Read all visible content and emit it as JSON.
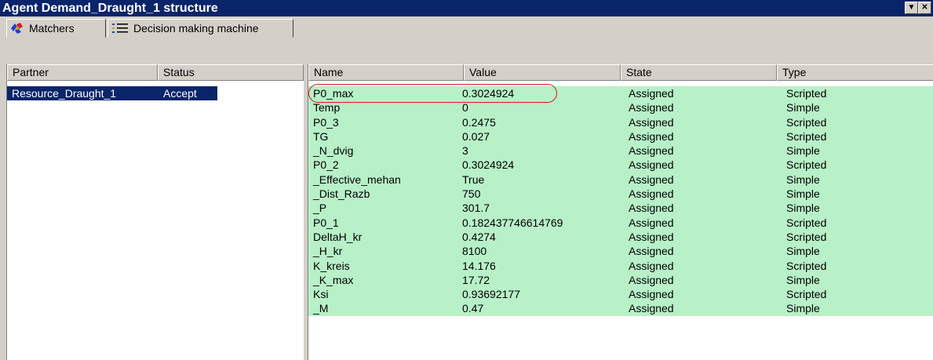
{
  "window": {
    "title": "Agent Demand_Draught_1 structure",
    "buttons": [
      "▼",
      "✕"
    ]
  },
  "tabs": [
    {
      "label": "Matchers",
      "icon": "matchers-icon",
      "active": true
    },
    {
      "label": "Decision making machine",
      "icon": "list-icon",
      "active": false
    }
  ],
  "left_table": {
    "columns": [
      "Partner",
      "Status"
    ],
    "rows": [
      {
        "partner": "Resource_Draught_1",
        "status": "Accept"
      }
    ]
  },
  "right_table": {
    "columns": [
      "Name",
      "Value",
      "State",
      "Type"
    ],
    "rows": [
      {
        "name": "P0_max",
        "value": "0.3024924",
        "state": "Assigned",
        "type": "Scripted"
      },
      {
        "name": "Temp",
        "value": "0",
        "state": "Assigned",
        "type": "Simple"
      },
      {
        "name": "P0_3",
        "value": "0.2475",
        "state": "Assigned",
        "type": "Scripted"
      },
      {
        "name": "TG",
        "value": "0.027",
        "state": "Assigned",
        "type": "Scripted"
      },
      {
        "name": "_N_dvig",
        "value": "3",
        "state": "Assigned",
        "type": "Simple"
      },
      {
        "name": "P0_2",
        "value": "0.3024924",
        "state": "Assigned",
        "type": "Scripted"
      },
      {
        "name": "_Effective_mehan",
        "value": "True",
        "state": "Assigned",
        "type": "Simple"
      },
      {
        "name": "_Dist_Razb",
        "value": "750",
        "state": "Assigned",
        "type": "Simple"
      },
      {
        "name": "_P",
        "value": "301.7",
        "state": "Assigned",
        "type": "Simple"
      },
      {
        "name": "P0_1",
        "value": "0.182437746614769",
        "state": "Assigned",
        "type": "Scripted"
      },
      {
        "name": "DeltaH_kr",
        "value": "0.4274",
        "state": "Assigned",
        "type": "Scripted"
      },
      {
        "name": "_H_kr",
        "value": "8100",
        "state": "Assigned",
        "type": "Simple"
      },
      {
        "name": "K_kreis",
        "value": "14.176",
        "state": "Assigned",
        "type": "Scripted"
      },
      {
        "name": "_K_max",
        "value": "17.72",
        "state": "Assigned",
        "type": "Simple"
      },
      {
        "name": "Ksi",
        "value": "0.93692177",
        "state": "Assigned",
        "type": "Scripted"
      },
      {
        "name": "_M",
        "value": "0.47",
        "state": "Assigned",
        "type": "Simple"
      }
    ]
  },
  "colors": {
    "title_bg": "#0a246a",
    "row_bg": "#b8f0c8",
    "highlight_oval": "#d81818",
    "selection_bg": "#0a246a"
  }
}
